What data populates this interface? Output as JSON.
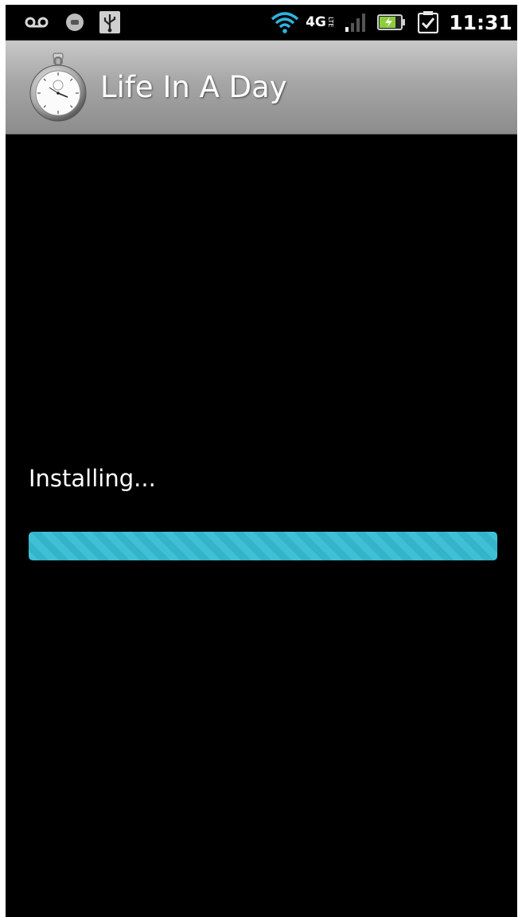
{
  "status_bar": {
    "time": "11:31",
    "network_label": "4G",
    "network_sub_label": "LTE",
    "icons": [
      "voicemail-icon",
      "emergency-icon",
      "usb-icon",
      "wifi-icon",
      "network-4g-lte-icon",
      "signal-strength-icon",
      "battery-charging-icon",
      "task-check-icon"
    ]
  },
  "app": {
    "title": "Life In A Day",
    "icon": "stopwatch-icon"
  },
  "install": {
    "status_text": "Installing...",
    "progress_fraction": 1.0,
    "indeterminate": true
  },
  "colors": {
    "title_bar_top": "#c9c9c9",
    "title_bar_bottom": "#8c8c8c",
    "background": "#000000",
    "progress": "#3fc0d6",
    "battery_fill": "#8ccd3c"
  }
}
